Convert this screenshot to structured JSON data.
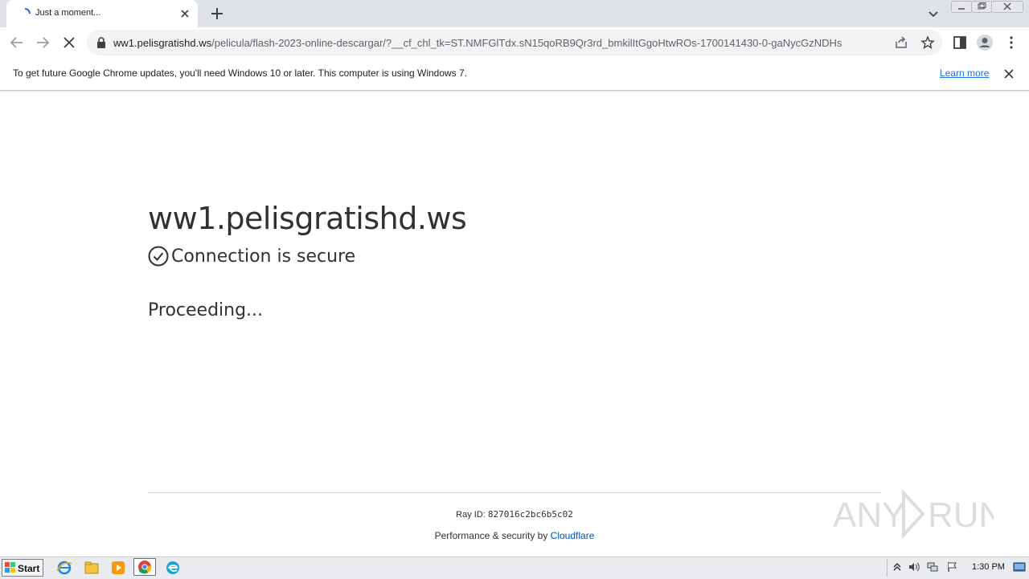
{
  "browser": {
    "tab_title": "Just a moment...",
    "url_host": "ww1.pelisgratishd.ws",
    "url_path": "/pelicula/flash-2023-online-descargar/?__cf_chl_tk=ST.NMFGlTdx.sN15qoRB9Qr3rd_bmkilItGgoHtwROs-1700141430-0-gaNycGzNDHs"
  },
  "infobar": {
    "message": "To get future Google Chrome updates, you'll need Windows 10 or later. This computer is using Windows 7.",
    "learn_more": "Learn more"
  },
  "page": {
    "host": "ww1.pelisgratishd.ws",
    "secure_text": "Connection is secure",
    "proceeding": "Proceeding...",
    "ray_label": "Ray ID:",
    "ray_id": "827016c2bc6b5c02",
    "perf_text": "Performance & security by",
    "perf_link": "Cloudflare"
  },
  "taskbar": {
    "start_label": "Start",
    "clock": "1:30 PM"
  },
  "colors": {
    "accent_link": "#1a73e8",
    "cloudflare_link": "#0051c3"
  }
}
